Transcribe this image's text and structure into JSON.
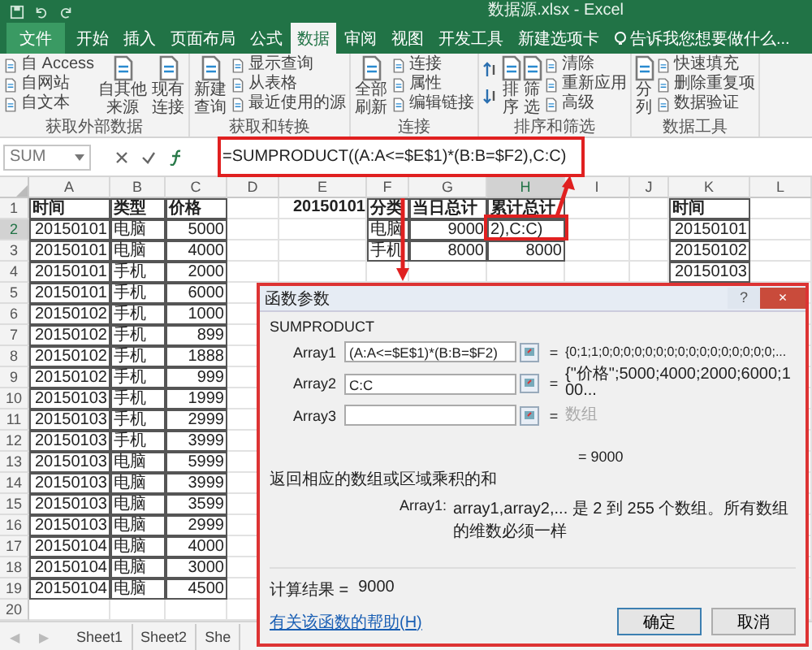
{
  "window": {
    "title": "数据源.xlsx - Excel"
  },
  "ribbon_tabs": [
    {
      "label": "文件",
      "kind": "file",
      "selected": false
    },
    {
      "label": "开始",
      "selected": false
    },
    {
      "label": "插入",
      "selected": false
    },
    {
      "label": "页面布局",
      "selected": false
    },
    {
      "label": "公式",
      "selected": false
    },
    {
      "label": "数据",
      "selected": true
    },
    {
      "label": "审阅",
      "selected": false
    },
    {
      "label": "视图",
      "selected": false
    },
    {
      "label": "开发工具",
      "selected": false
    },
    {
      "label": "新建选项卡",
      "selected": false
    }
  ],
  "tell_me": {
    "placeholder": "告诉我您想要做什么..."
  },
  "ribbon_groups": [
    {
      "label": "获取外部数据",
      "columns": [
        {
          "kind": "stack",
          "items": [
            "自 Access",
            "自网站",
            "自文本"
          ]
        },
        {
          "kind": "large",
          "label": "自其他来源"
        },
        {
          "kind": "large",
          "label": "现有连接"
        }
      ]
    },
    {
      "label": "获取和转换",
      "columns": [
        {
          "kind": "large",
          "label": "新建查询"
        },
        {
          "kind": "stack",
          "items": [
            "显示查询",
            "从表格",
            "最近使用的源"
          ]
        }
      ]
    },
    {
      "label": "连接",
      "columns": [
        {
          "kind": "large",
          "label": "全部刷新"
        },
        {
          "kind": "stack",
          "items": [
            "连接",
            "属性",
            "编辑链接"
          ]
        }
      ]
    },
    {
      "label": "排序和筛选",
      "columns": [
        {
          "kind": "sort"
        },
        {
          "kind": "large",
          "label": "排序"
        },
        {
          "kind": "large",
          "label": "筛选"
        },
        {
          "kind": "stack",
          "items": [
            "清除",
            "重新应用",
            "高级"
          ]
        }
      ]
    },
    {
      "label": "数据工具",
      "columns": [
        {
          "kind": "large",
          "label": "分列"
        },
        {
          "kind": "stack",
          "items": [
            "快速填充",
            "删除重复项",
            "数据验证"
          ]
        }
      ]
    }
  ],
  "formula_bar": {
    "name_box": "SUM",
    "formula": "=SUMPRODUCT((A:A<=$E$1)*(B:B=$F2),C:C)"
  },
  "columns": [
    {
      "label": "A",
      "selected": false
    },
    {
      "label": "B",
      "selected": false
    },
    {
      "label": "C",
      "selected": false
    },
    {
      "label": "D",
      "selected": false
    },
    {
      "label": "E",
      "selected": false
    },
    {
      "label": "F",
      "selected": false
    },
    {
      "label": "G",
      "selected": false
    },
    {
      "label": "H",
      "selected": true
    },
    {
      "label": "I",
      "selected": false
    },
    {
      "label": "J",
      "selected": false
    },
    {
      "label": "K",
      "selected": false
    },
    {
      "label": "L",
      "selected": false
    }
  ],
  "rows": [
    {
      "num": "1",
      "selected": false,
      "kind": "header",
      "cells": [
        "时间",
        "类型",
        "价格",
        null,
        "20150101",
        "分类",
        "当日总计",
        "累计总计",
        null,
        null,
        "时间"
      ]
    },
    {
      "num": "2",
      "selected": true,
      "cells": [
        "20150101",
        "电脑",
        "5000",
        null,
        null,
        "电脑",
        "9000",
        "2),C:C)",
        null,
        null,
        "20150101"
      ]
    },
    {
      "num": "3",
      "selected": false,
      "cells": [
        "20150101",
        "电脑",
        "4000",
        null,
        null,
        "手机",
        "8000",
        "8000",
        null,
        null,
        "20150102"
      ]
    },
    {
      "num": "4",
      "selected": false,
      "cells": [
        "20150101",
        "手机",
        "2000",
        null,
        null,
        null,
        null,
        null,
        null,
        null,
        "20150103"
      ]
    },
    {
      "num": "5",
      "selected": false,
      "cells": [
        "20150101",
        "手机",
        "6000"
      ]
    },
    {
      "num": "6",
      "selected": false,
      "cells": [
        "20150102",
        "手机",
        "1000"
      ]
    },
    {
      "num": "7",
      "selected": false,
      "cells": [
        "20150102",
        "手机",
        "899"
      ]
    },
    {
      "num": "8",
      "selected": false,
      "cells": [
        "20150102",
        "手机",
        "1888"
      ]
    },
    {
      "num": "9",
      "selected": false,
      "cells": [
        "20150102",
        "手机",
        "999"
      ]
    },
    {
      "num": "10",
      "selected": false,
      "cells": [
        "20150103",
        "手机",
        "1999"
      ]
    },
    {
      "num": "11",
      "selected": false,
      "cells": [
        "20150103",
        "手机",
        "2999"
      ]
    },
    {
      "num": "12",
      "selected": false,
      "cells": [
        "20150103",
        "手机",
        "3999"
      ]
    },
    {
      "num": "13",
      "selected": false,
      "cells": [
        "20150103",
        "电脑",
        "5999"
      ]
    },
    {
      "num": "14",
      "selected": false,
      "cells": [
        "20150103",
        "电脑",
        "3999"
      ]
    },
    {
      "num": "15",
      "selected": false,
      "cells": [
        "20150103",
        "电脑",
        "3599"
      ]
    },
    {
      "num": "16",
      "selected": false,
      "cells": [
        "20150103",
        "电脑",
        "2999"
      ]
    },
    {
      "num": "17",
      "selected": false,
      "cells": [
        "20150104",
        "电脑",
        "4000"
      ]
    },
    {
      "num": "18",
      "selected": false,
      "cells": [
        "20150104",
        "电脑",
        "3000"
      ]
    },
    {
      "num": "19",
      "selected": false,
      "cells": [
        "20150104",
        "电脑",
        "4500"
      ]
    },
    {
      "num": "20",
      "selected": false
    }
  ],
  "sheet_nav": [
    "◀",
    "▶"
  ],
  "sheets": [
    "Sheet1",
    "Sheet2",
    "She"
  ],
  "dialog": {
    "title": "函数参数",
    "title_buttons": [
      "?",
      "×"
    ],
    "function": "SUMPRODUCT",
    "args": [
      {
        "label": "Array1",
        "value": "(A:A<=$E$1)*(B:B=$F2)",
        "equals": "=",
        "result": "{0;1;1;0;0;0;0;0;0;0;0;0;0;0;0;0;0;0;0;...",
        "result_disabled": false
      },
      {
        "label": "Array2",
        "value": "C:C",
        "equals": "=",
        "result": "{\"价格\";5000;4000;2000;6000;100...",
        "result_disabled": false
      },
      {
        "label": "Array3",
        "equals": "=",
        "result": "数组",
        "result_disabled": true
      }
    ],
    "formula_result": "= 9000",
    "description": "返回相应的数组或区域乘积的和",
    "arg_help_label": "Array1:",
    "arg_help": "array1,array2,... 是 2 到 255 个数组。所有数组的维数必须一样",
    "result_label": "计算结果 =",
    "result_value": "9000",
    "help_link": "有关该函数的帮助(H)",
    "buttons": [
      "确定",
      "取消"
    ]
  }
}
